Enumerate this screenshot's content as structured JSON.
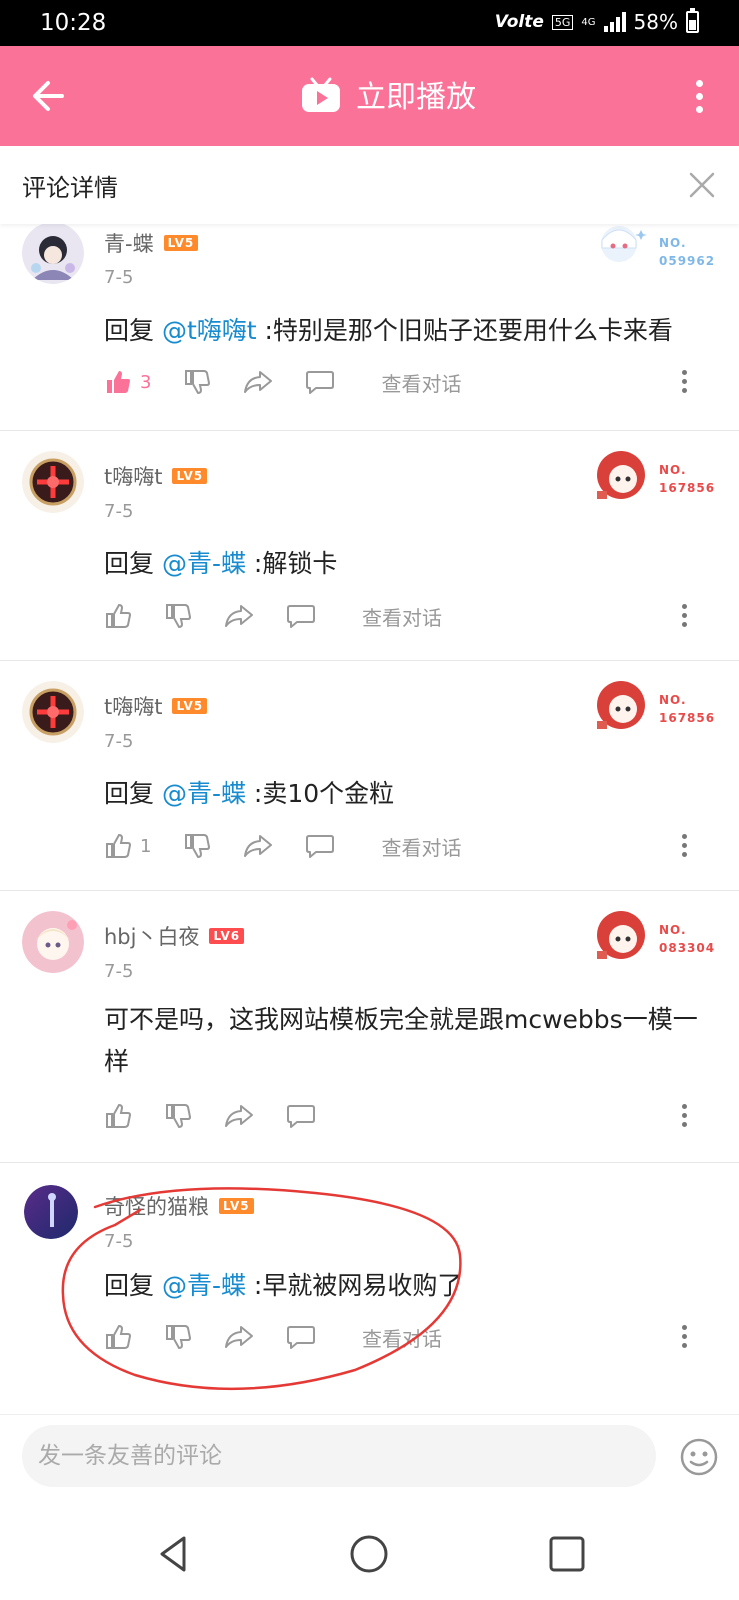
{
  "status": {
    "time": "10:28",
    "volte": "Volte",
    "network": "5G",
    "signal_type": "4G",
    "battery": "58%"
  },
  "appbar": {
    "play_label": "立即播放",
    "accent": "#fb7299"
  },
  "header": {
    "title": "评论详情"
  },
  "comments": [
    {
      "user": "青-蝶",
      "level": "LV5",
      "date": "7-5",
      "reply_prefix": "回复 ",
      "mention": "@t嗨嗨t",
      "text": " :特别是那个旧贴子还要用什么卡来看",
      "likes": "3",
      "liked": true,
      "view_convo": "查看对话",
      "badge": {
        "line1": "NO.",
        "line2": "059962"
      }
    },
    {
      "user": "t嗨嗨t",
      "level": "LV5",
      "date": "7-5",
      "reply_prefix": "回复 ",
      "mention": "@青-蝶",
      "text": " :解锁卡",
      "likes": "",
      "liked": false,
      "view_convo": "查看对话",
      "badge": {
        "line1": "NO.",
        "line2": "167856"
      }
    },
    {
      "user": "t嗨嗨t",
      "level": "LV5",
      "date": "7-5",
      "reply_prefix": "回复 ",
      "mention": "@青-蝶",
      "text": " :卖10个金粒",
      "likes": "1",
      "liked": false,
      "view_convo": "查看对话",
      "badge": {
        "line1": "NO.",
        "line2": "167856"
      }
    },
    {
      "user": "hbj丶白夜",
      "level": "LV6",
      "date": "7-5",
      "text": "可不是吗，这我网站模板完全就是跟mcwebbs一模一样",
      "likes": "",
      "liked": false,
      "badge": {
        "line1": "NO.",
        "line2": "083304"
      }
    },
    {
      "user": "奇怪的猫粮",
      "level": "LV5",
      "date": "7-5",
      "reply_prefix": "回复 ",
      "mention": "@青-蝶",
      "text": " :早就被网易收购了",
      "likes": "",
      "liked": false,
      "view_convo": "查看对话"
    }
  ],
  "input": {
    "placeholder": "发一条友善的评论"
  }
}
